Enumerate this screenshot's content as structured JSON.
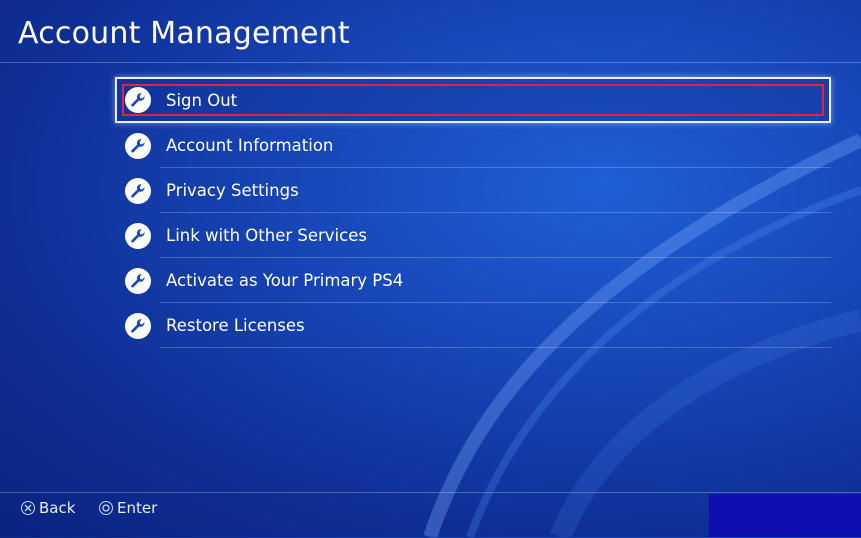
{
  "header": {
    "title": "Account Management"
  },
  "menu": {
    "items": [
      {
        "label": "Sign Out",
        "icon": "wrench-icon",
        "selected": true
      },
      {
        "label": "Account Information",
        "icon": "wrench-icon",
        "selected": false
      },
      {
        "label": "Privacy Settings",
        "icon": "wrench-icon",
        "selected": false
      },
      {
        "label": "Link with Other Services",
        "icon": "wrench-icon",
        "selected": false
      },
      {
        "label": "Activate as Your Primary PS4",
        "icon": "wrench-icon",
        "selected": false
      },
      {
        "label": "Restore Licenses",
        "icon": "wrench-icon",
        "selected": false
      }
    ]
  },
  "footer": {
    "back_label": "Back",
    "back_icon": "cross-button-icon",
    "enter_label": "Enter",
    "enter_icon": "circle-button-icon"
  },
  "colors": {
    "background": "#1747b8",
    "highlight": "#e8213a",
    "focus_border": "#e9f1ff",
    "corner_block": "#0e0fae"
  }
}
